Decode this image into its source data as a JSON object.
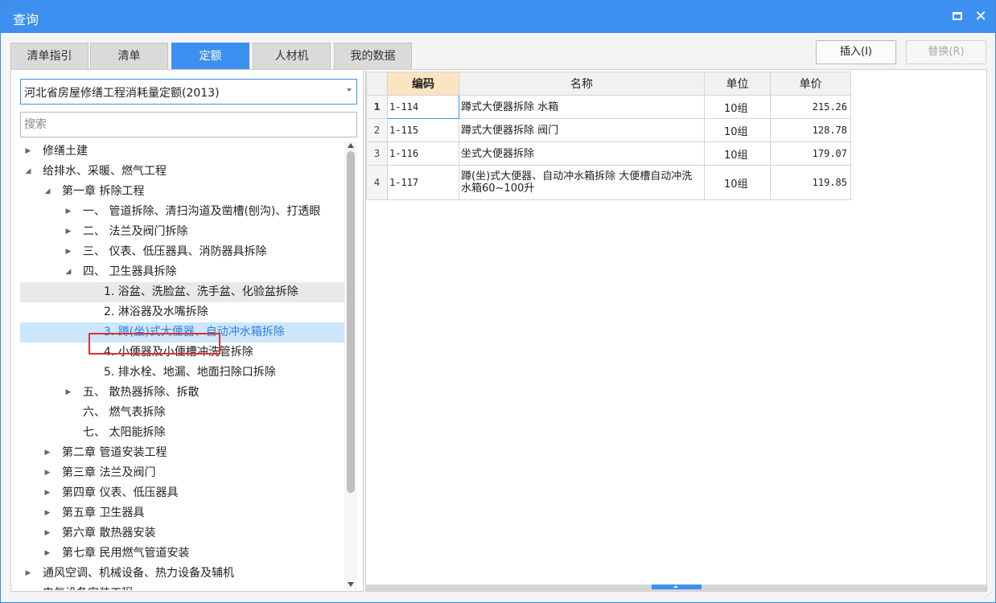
{
  "window": {
    "title": "查询",
    "maximize_icon": "maximize-icon",
    "close_icon": "close-icon",
    "close_glyph": "✕"
  },
  "tabs": [
    {
      "label": "清单指引",
      "active": false
    },
    {
      "label": "清单",
      "active": false
    },
    {
      "label": "定额",
      "active": true
    },
    {
      "label": "人材机",
      "active": false
    },
    {
      "label": "我的数据",
      "active": false
    }
  ],
  "buttons": {
    "insert": "插入(I)",
    "replace": "替换(R)"
  },
  "left": {
    "library_select": "河北省房屋修缮工程消耗量定额(2013)",
    "search_placeholder": "搜索",
    "tree": [
      {
        "label": "修缮土建",
        "toggle": "▶"
      },
      {
        "label": "给排水、采暖、燃气工程",
        "toggle": "◢"
      },
      {
        "label": "第一章 拆除工程",
        "toggle": "◢"
      },
      {
        "label": "一、 管道拆除、清扫沟道及凿槽(刨沟)、打透眼",
        "toggle": "▶"
      },
      {
        "label": "二、 法兰及阀门拆除",
        "toggle": "▶"
      },
      {
        "label": "三、 仪表、低压器具、消防器具拆除",
        "toggle": "▶"
      },
      {
        "label": "四、 卫生器具拆除",
        "toggle": "◢"
      },
      {
        "label": "1. 浴盆、洗脸盆、洗手盆、化验盆拆除",
        "toggle": ""
      },
      {
        "label": "2. 淋浴器及水嘴拆除",
        "toggle": ""
      },
      {
        "label": "3. 蹲(坐)式大便器、自动冲水箱拆除",
        "toggle": ""
      },
      {
        "label": "4. 小便器及小便槽冲洗管拆除",
        "toggle": ""
      },
      {
        "label": "5. 排水栓、地漏、地面扫除口拆除",
        "toggle": ""
      },
      {
        "label": "五、 散热器拆除、拆散",
        "toggle": "▶"
      },
      {
        "label": "六、 燃气表拆除",
        "toggle": ""
      },
      {
        "label": "七、 太阳能拆除",
        "toggle": ""
      },
      {
        "label": "第二章 管道安装工程",
        "toggle": "▶"
      },
      {
        "label": "第三章 法兰及阀门",
        "toggle": "▶"
      },
      {
        "label": "第四章 仪表、低压器具",
        "toggle": "▶"
      },
      {
        "label": "第五章 卫生器具",
        "toggle": "▶"
      },
      {
        "label": "第六章 散热器安装",
        "toggle": "▶"
      },
      {
        "label": "第七章 民用燃气管道安装",
        "toggle": "▶"
      },
      {
        "label": "通风空调、机械设备、热力设备及辅机",
        "toggle": "▶"
      },
      {
        "label": "电气设备安装工程",
        "toggle": "▶"
      }
    ]
  },
  "grid": {
    "columns": [
      "编码",
      "名称",
      "单位",
      "单价"
    ],
    "rows": [
      {
        "idx": "1",
        "code": "1-114",
        "name": "蹲式大便器拆除 水箱",
        "unit": "10组",
        "price": "215.26"
      },
      {
        "idx": "2",
        "code": "1-115",
        "name": "蹲式大便器拆除 阀门",
        "unit": "10组",
        "price": "128.78"
      },
      {
        "idx": "3",
        "code": "1-116",
        "name": "坐式大便器拆除",
        "unit": "10组",
        "price": "179.07"
      },
      {
        "idx": "4",
        "code": "1-117",
        "name": "蹲(坐)式大便器、自动冲水箱拆除 大便槽自动冲洗水箱60~100升",
        "unit": "10组",
        "price": "119.85"
      }
    ]
  },
  "colors": {
    "accent": "#3d8ff0",
    "selected_bg": "#cce6fb",
    "highlight_border": "#e03030",
    "code_header_bg": "#fbe4c2"
  }
}
